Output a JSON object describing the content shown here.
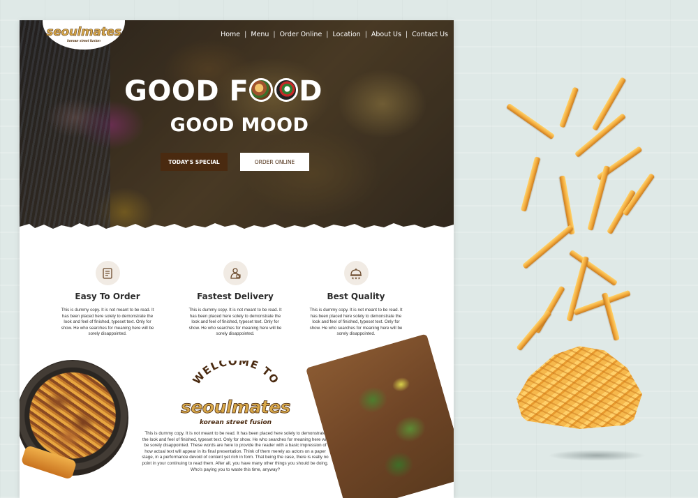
{
  "site": {
    "brand": "seoulmates",
    "brand_tag": "korean street fusion",
    "nav": [
      "Home",
      "Menu",
      "Order Online",
      "Location",
      "About Us",
      "Contact Us"
    ],
    "nav_separator": "|",
    "hero": {
      "headline_part1": "GOOD F",
      "headline_part2": "D",
      "headline_line2": "GOOD MOOD",
      "btn_special": "TODAY'S SPECIAL",
      "btn_order": "ORDER ONLINE"
    },
    "features": [
      {
        "icon": "order-icon",
        "title": "Easy To Order",
        "text": "This is dummy copy. It is not meant to be read. It has been placed here solely to demonstrate the look and feel of finished, typeset text. Only for show. He who searches for meaning here will be sorely disappointed."
      },
      {
        "icon": "delivery-icon",
        "title": "Fastest Delivery",
        "text": "This is dummy copy. It is not meant to be read. It has been placed here solely to demonstrate the look and feel of finished, typeset text. Only for show. He who searches for meaning here will be sorely disappointed."
      },
      {
        "icon": "quality-icon",
        "title": "Best Quality",
        "text": "This is dummy copy. It is not meant to be read. It has been placed here solely to demonstrate the look and feel of finished, typeset text. Only for show. He who searches for meaning here will be sorely disappointed."
      }
    ],
    "welcome": {
      "arc_text": "WELCOME TO",
      "brand": "seoulmates",
      "tag": "korean street fusion",
      "body": "This is dummy copy. It is not meant to be read. It has been placed here solely to demonstrate the look and feel of finished, typeset text. Only for show. He who searches for meaning here will be sorely disappointed. These words are here to provide the reader with a basic impression of how actual text will appear in its final presentation. Think of them merely as actors on a paper stage, in a performance devoid of content yet rich in form. That being the case, there is really no point in your continuing to read them. After all, you have many other things you should be doing. Who's paying you to waste this time, anyway?"
    }
  },
  "colors": {
    "accent_brown": "#4a2a10",
    "brand_gold": "#d8a84a",
    "background": "#dfe9e7"
  }
}
